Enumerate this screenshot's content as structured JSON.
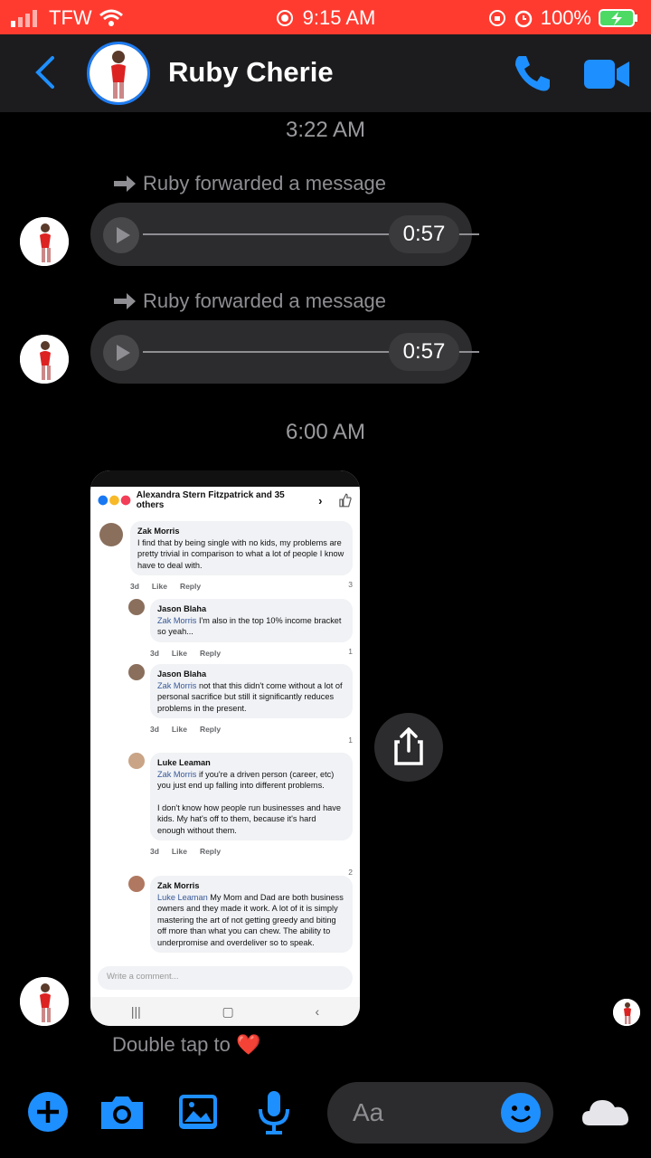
{
  "status_bar": {
    "carrier": "TFW",
    "time": "9:15 AM",
    "battery": "100%"
  },
  "header": {
    "contact_name": "Ruby Cherie"
  },
  "messages": [
    {
      "timestamp": "3:22 AM"
    },
    {
      "forwarded_label": "Ruby forwarded a message",
      "duration": "0:57"
    },
    {
      "forwarded_label": "Ruby forwarded a message",
      "duration": "0:57"
    },
    {
      "timestamp": "6:00 AM"
    }
  ],
  "shared_screenshot": {
    "reactions_text": "Alexandra Stern Fitzpatrick and 35 others",
    "comments": [
      {
        "name": "Zak Morris",
        "mention": "",
        "text": "I find that by being single with no kids, my problems are pretty trivial in comparison to what a lot of people I know have to deal with.",
        "age": "3d",
        "like": "Like",
        "reply": "Reply",
        "count": "3"
      },
      {
        "name": "Jason Blaha",
        "mention": "Zak Morris",
        "text": "I'm also in the top 10% income bracket so yeah...",
        "age": "3d",
        "like": "Like",
        "reply": "Reply",
        "count": "1"
      },
      {
        "name": "Jason Blaha",
        "mention": "Zak Morris",
        "text": "not that this didn't come without a lot of personal sacrifice but still it significantly reduces problems in the present.",
        "age": "3d",
        "like": "Like",
        "reply": "Reply",
        "count": "1"
      },
      {
        "name": "Luke Leaman",
        "mention": "Zak Morris",
        "text": "if you're a driven person (career, etc) you just end up falling into different problems.",
        "text2": "I don't know how people run businesses and have kids. My hat's off to them, because it's hard enough without them.",
        "age": "3d",
        "like": "Like",
        "reply": "Reply",
        "count": "2"
      },
      {
        "name": "Zak Morris",
        "mention": "Luke Leaman",
        "text": "My Mom and Dad are both business owners and they made it work. A lot of it is simply mastering the art of not getting greedy and biting off more than what you can chew. The ability to underpromise and overdeliver so to speak."
      }
    ],
    "write_placeholder": "Write a comment..."
  },
  "double_tap_text": "Double tap to ❤️",
  "composer": {
    "placeholder": "Aa"
  },
  "colors": {
    "status_bar": "#ff3b30",
    "accent": "#1e7cf2",
    "bubble": "#2c2c2e"
  }
}
